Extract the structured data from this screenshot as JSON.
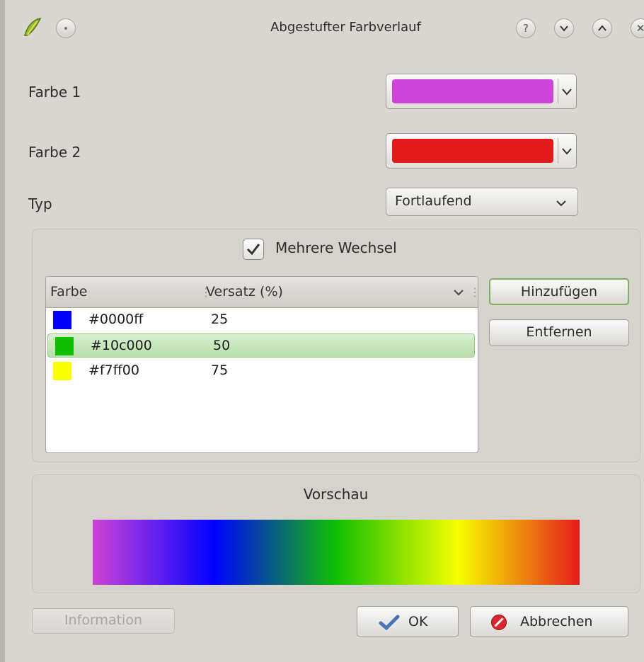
{
  "window": {
    "title": "Abgestufter Farbverlauf",
    "title_buttons": [
      "?",
      "⌄",
      "⌃",
      "✕"
    ]
  },
  "form": {
    "color1": {
      "label": "Farbe 1",
      "value": "#d043d8"
    },
    "color2": {
      "label": "Farbe 2",
      "value": "#e41b1b"
    },
    "type": {
      "label": "Typ",
      "value": "Fortlaufend"
    }
  },
  "stops": {
    "checkbox_label": "Mehrere Wechsel",
    "checked": true,
    "columns": [
      "Farbe",
      "Versatz (%)"
    ],
    "rows": [
      {
        "color": "#0000ff",
        "hex": "#0000ff",
        "offset": "25",
        "selected": false
      },
      {
        "color": "#10c000",
        "hex": "#10c000",
        "offset": "50",
        "selected": true
      },
      {
        "color": "#f7ff00",
        "hex": "#f7ff00",
        "offset": "75",
        "selected": false
      }
    ],
    "add_label": "Hinzufügen",
    "remove_label": "Entfernen"
  },
  "preview": {
    "title": "Vorschau",
    "gradient": [
      "#d043d8",
      "#0000ff",
      "#10c000",
      "#f7ff00",
      "#e41b1b"
    ]
  },
  "footer": {
    "info_label": "Information",
    "ok_label": "OK",
    "cancel_label": "Abbrechen"
  }
}
